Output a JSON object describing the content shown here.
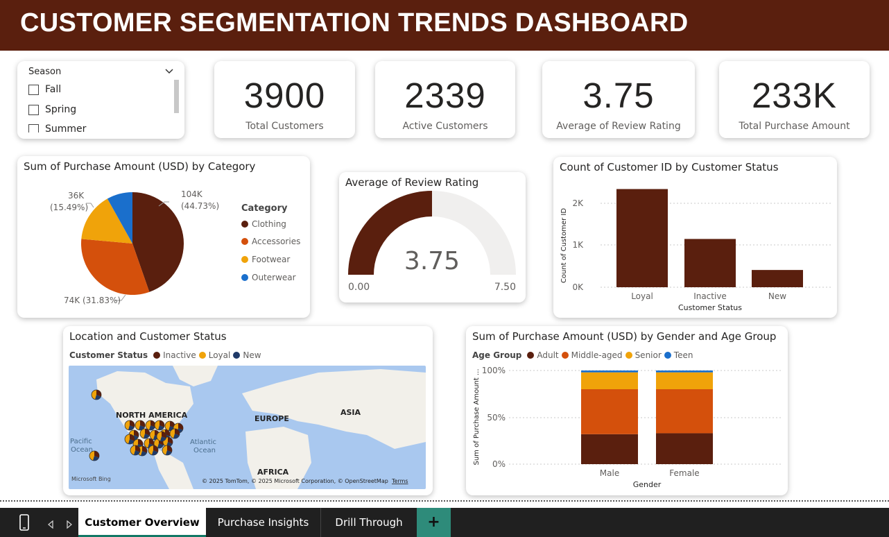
{
  "header": {
    "title": "CUSTOMER SEGMENTATION TRENDS DASHBOARD"
  },
  "slicer": {
    "title": "Season",
    "items": [
      "Fall",
      "Spring",
      "Summer"
    ]
  },
  "kpis": [
    {
      "value": "3900",
      "label": "Total Customers"
    },
    {
      "value": "2339",
      "label": "Active Customers"
    },
    {
      "value": "3.75",
      "label": "Average of Review Rating"
    },
    {
      "value": "233K",
      "label": "Total Purchase Amount"
    }
  ],
  "pie": {
    "title": "Sum of Purchase Amount (USD) by Category",
    "legend_title": "Category",
    "label_104k": "104K",
    "label_104k_pct": "(44.73%)",
    "label_36k": "36K",
    "label_36k_pct": "(15.49%)",
    "label_74k": "74K (31.83%)"
  },
  "gauge": {
    "title": "Average of Review Rating",
    "value_label": "3.75",
    "min_label": "0.00",
    "max_label": "7.50"
  },
  "status_bar": {
    "title": "Count of Customer ID by Customer Status",
    "ylabel": "Count of Customer ID",
    "xlabel": "Customer Status",
    "ticks": [
      "2K",
      "1K",
      "0K"
    ]
  },
  "map": {
    "title": "Location and Customer Status",
    "legend_title": "Customer Status",
    "legend": [
      "Inactive",
      "Loyal",
      "New"
    ],
    "labels": {
      "north_america": "NORTH AMERICA",
      "europe": "EUROPE",
      "asia": "ASIA",
      "africa": "AFRICA",
      "pacific": "Pacific",
      "ocean1": "Ocean",
      "atlantic": "Atlantic",
      "ocean2": "Ocean"
    },
    "bing": "Microsoft Bing",
    "credits": "© 2025 TomTom, © 2025 Microsoft Corporation, © OpenStreetMap",
    "terms": "Terms"
  },
  "stacked": {
    "title": "Sum of Purchase Amount (USD) by Gender and Age Group",
    "legend_title": "Age Group",
    "legend": [
      "Adult",
      "Middle-aged",
      "Senior",
      "Teen"
    ],
    "ylabel": "Sum of Purchase Amount ...",
    "xlabel": "Gender",
    "ticks": [
      "100%",
      "50%",
      "0%"
    ]
  },
  "tabs": [
    "Customer Overview",
    "Purchase Insights",
    "Drill Through"
  ],
  "tab_add": "+",
  "colors": {
    "header": "#5a1f0e",
    "clothing": "#5a1f0e",
    "accessories": "#d4500c",
    "footwear": "#f0a30a",
    "outerwear": "#1a6fcc",
    "new": "#1f3a68"
  },
  "chart_data": [
    {
      "type": "pie",
      "title": "Sum of Purchase Amount (USD) by Category",
      "categories": [
        "Clothing",
        "Accessories",
        "Footwear",
        "Outerwear"
      ],
      "values": [
        104,
        74,
        36,
        18.9
      ],
      "percent": [
        44.73,
        31.83,
        15.49,
        7.95
      ]
    },
    {
      "type": "bar",
      "title": "Count of Customer ID by Customer Status",
      "categories": [
        "Loyal",
        "Inactive",
        "New"
      ],
      "values": [
        2339,
        1150,
        411
      ],
      "ylim": [
        0,
        2500
      ]
    },
    {
      "type": "bar",
      "title": "Sum of Purchase Amount (USD) by Gender and Age Group",
      "categories": [
        "Male",
        "Female"
      ],
      "series": [
        {
          "name": "Adult",
          "values": [
            32,
            33
          ]
        },
        {
          "name": "Middle-aged",
          "values": [
            48,
            47
          ]
        },
        {
          "name": "Senior",
          "values": [
            18,
            18
          ]
        },
        {
          "name": "Teen",
          "values": [
            2,
            2
          ]
        }
      ],
      "ylim": [
        0,
        100
      ]
    }
  ]
}
